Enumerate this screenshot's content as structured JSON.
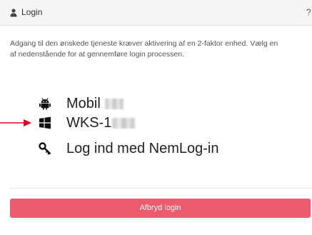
{
  "header": {
    "title": "Login",
    "help_icon": "question-icon",
    "user_icon": "user-icon"
  },
  "intro": {
    "line1": "Adgang til den ønskede tjeneste kræver aktivering af en 2-faktor enhed. Vælg en",
    "line2": "af nedenstående for at gennemføre login processen."
  },
  "options": [
    {
      "label": "Mobil",
      "icon": "android-icon"
    },
    {
      "label": "WKS-1",
      "icon": "windows-icon"
    },
    {
      "label": "Log ind med NemLog-in",
      "icon": "key-icon"
    }
  ],
  "actions": {
    "cancel_label": "Afbryd login"
  },
  "colors": {
    "header_bg": "#f5f5f5",
    "cancel_bg": "#ee5a6d",
    "arrow": "#e8001c"
  }
}
